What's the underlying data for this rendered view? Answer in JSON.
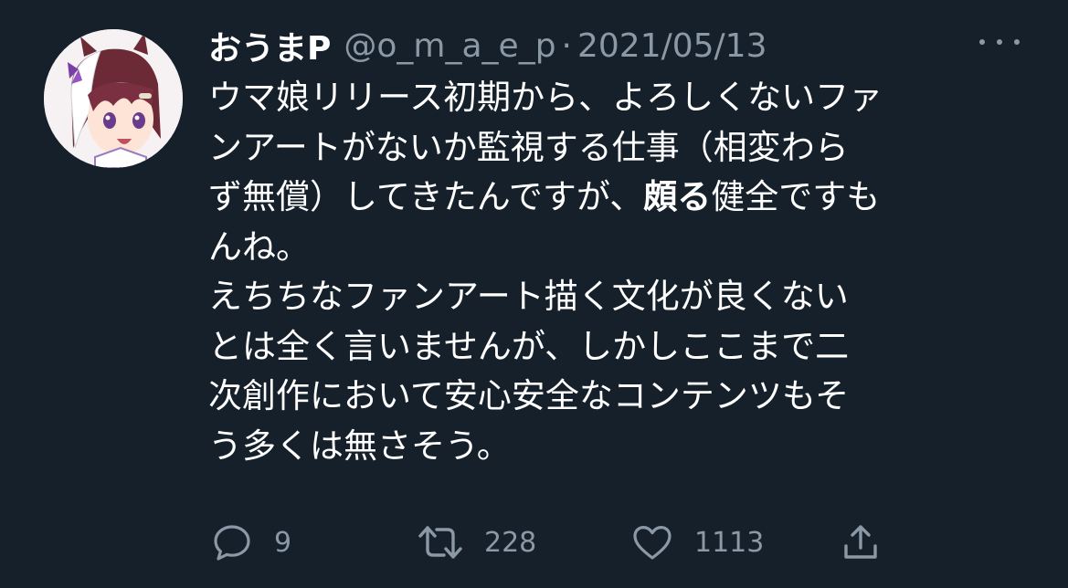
{
  "tweet": {
    "display_name": "おうまP",
    "handle": "@o_m_a_e_p",
    "separator": "·",
    "date": "2021/05/13",
    "body_lines": [
      [
        "ウマ娘リリース初期から、よろしくないファ"
      ],
      [
        "ンアートがないか監視する仕事（相変わら"
      ],
      [
        "ず無償）してきたんですが、",
        "頗る",
        "健全ですも"
      ],
      [
        "んね。"
      ],
      [
        "えちちなファンアート描く文化が良くない"
      ],
      [
        "とは全く言いませんが、しかしここまで二"
      ],
      [
        "次創作において安心安全なコンテンツもそ"
      ],
      [
        "う多くは無さそう。"
      ]
    ]
  },
  "actions": {
    "reply_count": "9",
    "retweet_count": "228",
    "like_count": "1113"
  },
  "icons": {
    "more": "more-options-icon",
    "reply": "reply-icon",
    "retweet": "retweet-icon",
    "like": "heart-icon",
    "share": "share-icon"
  },
  "colors": {
    "background": "#15202b",
    "text": "#ffffff",
    "secondary_text": "#8b98a5"
  }
}
